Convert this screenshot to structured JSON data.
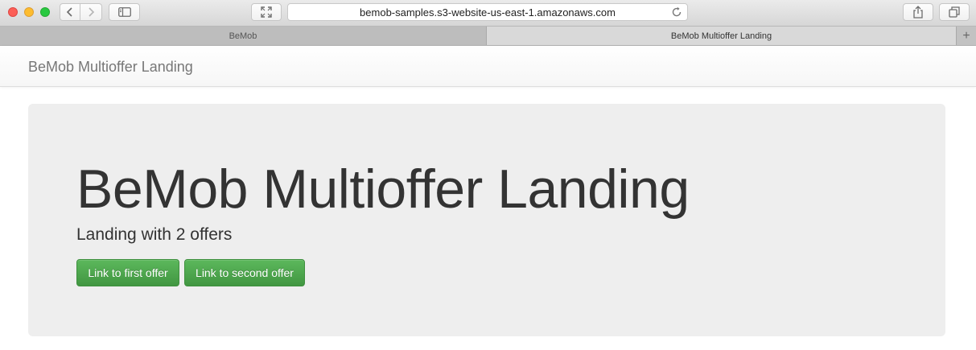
{
  "browser": {
    "url": "bemob-samples.s3-website-us-east-1.amazonaws.com",
    "tabs": [
      {
        "label": "BeMob",
        "active": false
      },
      {
        "label": "BeMob Multioffer Landing",
        "active": true
      }
    ],
    "new_tab_label": "+"
  },
  "navbar": {
    "brand": "BeMob Multioffer Landing"
  },
  "jumbotron": {
    "title": "BeMob Multioffer Landing",
    "subtitle": "Landing with 2 offers",
    "buttons": [
      {
        "label": "Link to first offer"
      },
      {
        "label": "Link to second offer"
      }
    ]
  },
  "colors": {
    "button_green": "#449d44",
    "jumbotron_bg": "#eeeeee",
    "brand_text": "#777777"
  }
}
